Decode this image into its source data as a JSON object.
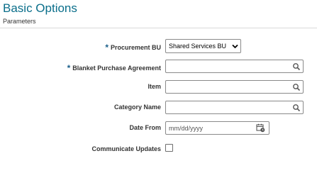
{
  "header": {
    "title": "Basic Options",
    "subtitle": "Parameters"
  },
  "form": {
    "procurement_bu": {
      "label": "Procurement BU",
      "required_marker": "*",
      "value": "Shared Services BU",
      "icon": "chevron-down-icon"
    },
    "blanket_purchase_agreement": {
      "label": "Blanket Purchase Agreement",
      "required_marker": "*",
      "value": "",
      "icon": "search-icon"
    },
    "item": {
      "label": "Item",
      "value": "",
      "icon": "search-icon"
    },
    "category_name": {
      "label": "Category Name",
      "value": "",
      "icon": "search-icon"
    },
    "date_from": {
      "label": "Date From",
      "placeholder": "mm/dd/yyyy",
      "icon": "calendar-icon"
    },
    "communicate_updates": {
      "label": "Communicate Updates",
      "checked": false
    }
  },
  "colors": {
    "title": "#0a6e8a",
    "required_marker": "#1a5f8a",
    "field_border": "#8a8a8a"
  }
}
